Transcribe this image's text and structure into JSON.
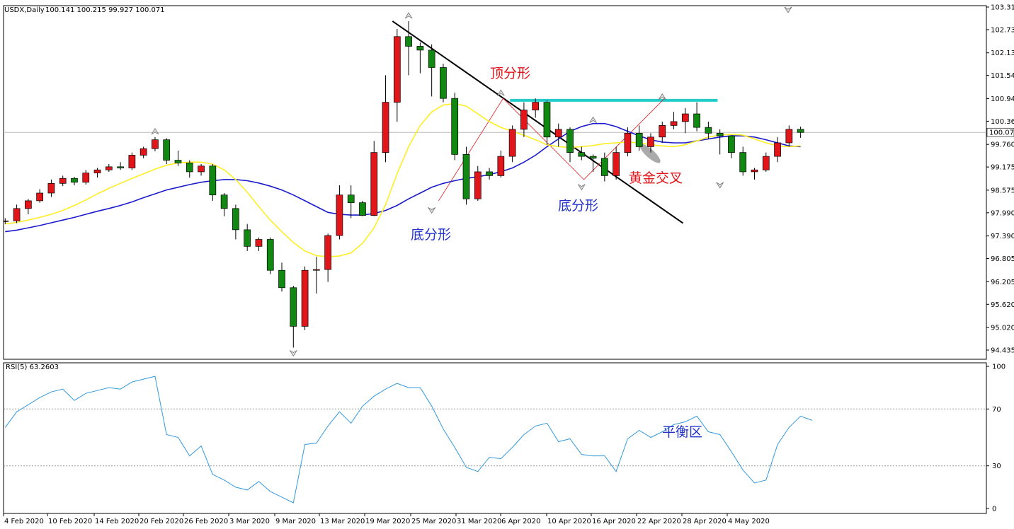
{
  "main_panel": {
    "symbol_label": "USDX,Daily",
    "ohlc_label": "100.141 100.215 99.927 100.071",
    "current_price_label": "100.071"
  },
  "rsi_panel": {
    "label": "RSI(5) 63.2603"
  },
  "annotations": {
    "top_fractal": "顶分形",
    "bottom_fractal_1": "底分形",
    "bottom_fractal_2": "底分形",
    "golden_cross": "黄金交叉",
    "balance_zone": "平衡区"
  },
  "colors": {
    "bull": "#e0161b",
    "bear": "#118811",
    "ma_fast": "#ffee22",
    "ma_slow": "#1a1acc",
    "rsi_line": "#3399dd",
    "resistance": "#22cccc",
    "annotation_red": "#e0161b",
    "annotation_blue": "#2233cc"
  },
  "chart_data": [
    {
      "type": "candlestick",
      "symbol": "USDX",
      "timeframe": "Daily",
      "y_ticks": [
        "103.315",
        "102.730",
        "102.130",
        "101.545",
        "100.945",
        "100.360",
        "99.760",
        "99.175",
        "98.575",
        "97.990",
        "97.390",
        "96.805",
        "96.205",
        "95.620",
        "95.020",
        "94.435"
      ],
      "ylim": [
        94.435,
        103.315
      ],
      "x_ticks": [
        "4 Feb 2020",
        "10 Feb 2020",
        "14 Feb 2020",
        "20 Feb 2020",
        "26 Feb 2020",
        "3 Mar 2020",
        "9 Mar 2020",
        "13 Mar 2020",
        "19 Mar 2020",
        "25 Mar 2020",
        "31 Mar 2020",
        "6 Apr 2020",
        "10 Apr 2020",
        "16 Apr 2020",
        "22 Apr 2020",
        "28 Apr 2020",
        "4 May 2020"
      ],
      "candles": [
        [
          97.78,
          97.85,
          97.7,
          97.78
        ],
        [
          97.78,
          98.2,
          97.72,
          98.1
        ],
        [
          98.1,
          98.35,
          97.95,
          98.3
        ],
        [
          98.3,
          98.6,
          98.25,
          98.5
        ],
        [
          98.5,
          98.85,
          98.4,
          98.75
        ],
        [
          98.75,
          98.95,
          98.68,
          98.88
        ],
        [
          98.88,
          98.92,
          98.7,
          98.78
        ],
        [
          98.78,
          99.1,
          98.72,
          99.02
        ],
        [
          99.02,
          99.15,
          98.9,
          99.1
        ],
        [
          99.1,
          99.25,
          99.05,
          99.18
        ],
        [
          99.18,
          99.3,
          99.1,
          99.15
        ],
        [
          99.15,
          99.55,
          99.1,
          99.48
        ],
        [
          99.48,
          99.7,
          99.4,
          99.65
        ],
        [
          99.65,
          99.95,
          99.58,
          99.88
        ],
        [
          99.88,
          99.92,
          99.25,
          99.35
        ],
        [
          99.35,
          99.6,
          99.2,
          99.28
        ],
        [
          99.28,
          99.35,
          98.9,
          99.05
        ],
        [
          99.05,
          99.25,
          98.95,
          99.2
        ],
        [
          99.2,
          99.25,
          98.3,
          98.45
        ],
        [
          98.45,
          98.5,
          97.9,
          98.1
        ],
        [
          98.1,
          98.2,
          97.3,
          97.55
        ],
        [
          97.55,
          97.7,
          97.0,
          97.12
        ],
        [
          97.12,
          97.35,
          97.0,
          97.3
        ],
        [
          97.3,
          97.35,
          96.4,
          96.5
        ],
        [
          96.5,
          96.7,
          95.95,
          96.05
        ],
        [
          96.05,
          96.1,
          94.5,
          95.05
        ],
        [
          95.05,
          96.6,
          94.95,
          96.5
        ],
        [
          96.5,
          96.85,
          95.9,
          96.52
        ],
        [
          96.52,
          97.45,
          96.2,
          97.4
        ],
        [
          97.4,
          98.7,
          97.3,
          98.45
        ],
        [
          98.45,
          98.7,
          97.85,
          98.25
        ],
        [
          98.25,
          98.3,
          97.9,
          97.92
        ],
        [
          97.92,
          99.85,
          97.9,
          99.55
        ],
        [
          99.55,
          101.55,
          99.3,
          100.85
        ],
        [
          100.85,
          102.75,
          100.35,
          102.55
        ],
        [
          102.55,
          102.95,
          101.55,
          102.3
        ],
        [
          102.3,
          102.4,
          101.6,
          102.2
        ],
        [
          102.2,
          102.35,
          101.0,
          101.75
        ],
        [
          101.75,
          101.85,
          100.85,
          100.95
        ],
        [
          100.95,
          101.1,
          99.35,
          99.5
        ],
        [
          99.5,
          99.7,
          98.2,
          98.35
        ],
        [
          98.35,
          99.2,
          98.3,
          99.05
        ],
        [
          99.05,
          99.15,
          98.85,
          98.95
        ],
        [
          98.95,
          99.6,
          98.9,
          99.45
        ],
        [
          99.45,
          100.25,
          99.3,
          100.15
        ],
        [
          100.15,
          100.85,
          99.95,
          100.65
        ],
        [
          100.65,
          100.95,
          100.45,
          100.85
        ],
        [
          100.85,
          100.9,
          99.75,
          99.95
        ],
        [
          99.95,
          100.3,
          99.7,
          100.15
        ],
        [
          100.15,
          100.2,
          99.3,
          99.55
        ],
        [
          99.55,
          99.7,
          99.35,
          99.45
        ],
        [
          99.45,
          99.5,
          99.05,
          99.4
        ],
        [
          99.4,
          99.55,
          98.8,
          98.95
        ],
        [
          98.95,
          99.7,
          98.85,
          99.55
        ],
        [
          99.55,
          100.2,
          99.45,
          100.05
        ],
        [
          100.05,
          100.25,
          99.6,
          99.7
        ],
        [
          99.7,
          100.05,
          99.55,
          99.95
        ],
        [
          99.95,
          100.35,
          99.8,
          100.25
        ],
        [
          100.25,
          100.6,
          100.15,
          100.35
        ],
        [
          100.35,
          100.7,
          100.05,
          100.55
        ],
        [
          100.55,
          100.85,
          100.1,
          100.2
        ],
        [
          100.2,
          100.35,
          99.9,
          100.05
        ],
        [
          100.05,
          100.15,
          99.5,
          99.98
        ],
        [
          99.98,
          100.0,
          99.4,
          99.55
        ],
        [
          99.55,
          99.7,
          98.95,
          99.05
        ],
        [
          99.05,
          99.15,
          98.85,
          99.1
        ],
        [
          99.1,
          99.55,
          99.05,
          99.45
        ],
        [
          99.45,
          99.95,
          99.3,
          99.8
        ],
        [
          99.8,
          100.25,
          99.7,
          100.15
        ],
        [
          100.15,
          100.22,
          99.93,
          100.07
        ]
      ],
      "ma_fast": [
        97.7,
        97.74,
        97.8,
        97.87,
        97.95,
        98.05,
        98.18,
        98.32,
        98.48,
        98.62,
        98.75,
        98.88,
        99.0,
        99.12,
        99.22,
        99.28,
        99.3,
        99.3,
        99.25,
        99.1,
        98.85,
        98.52,
        98.15,
        97.8,
        97.5,
        97.22,
        97.0,
        96.88,
        96.85,
        96.87,
        96.95,
        97.2,
        97.6,
        98.2,
        99.0,
        99.7,
        100.25,
        100.6,
        100.78,
        100.82,
        100.75,
        100.55,
        100.35,
        100.2,
        100.1,
        100.0,
        99.88,
        99.75,
        99.7,
        99.68,
        99.7,
        99.73,
        99.78,
        99.8,
        99.82,
        99.8,
        99.75,
        99.72,
        99.7,
        99.75,
        99.85,
        99.95,
        100.0,
        100.02,
        100.0,
        99.9,
        99.8,
        99.72,
        99.7,
        99.72
      ],
      "ma_slow": [
        97.5,
        97.54,
        97.6,
        97.66,
        97.73,
        97.8,
        97.87,
        97.95,
        98.03,
        98.1,
        98.18,
        98.27,
        98.38,
        98.48,
        98.58,
        98.65,
        98.72,
        98.78,
        98.82,
        98.85,
        98.85,
        98.82,
        98.76,
        98.68,
        98.58,
        98.45,
        98.3,
        98.15,
        98.0,
        97.95,
        97.93,
        97.93,
        97.97,
        98.05,
        98.18,
        98.35,
        98.5,
        98.65,
        98.75,
        98.82,
        98.88,
        98.92,
        98.98,
        99.05,
        99.15,
        99.3,
        99.48,
        99.7,
        99.9,
        100.1,
        100.22,
        100.3,
        100.3,
        100.22,
        100.1,
        99.98,
        99.88,
        99.82,
        99.8,
        99.8,
        99.85,
        99.9,
        99.95,
        99.98,
        99.98,
        99.95,
        99.88,
        99.8,
        99.72,
        99.7
      ],
      "annotations": {
        "resistance_level": 100.9
      }
    },
    {
      "type": "line",
      "name": "RSI(5)",
      "last_value": 63.2603,
      "y_ticks": [
        "100",
        "70",
        "30",
        "0"
      ],
      "ylim": [
        0,
        100
      ],
      "levels": [
        30,
        70
      ],
      "values": [
        57,
        68,
        73,
        78,
        82,
        84,
        76,
        81,
        83,
        85,
        84,
        89,
        91,
        93,
        52,
        50,
        37,
        44,
        24,
        20,
        15,
        13,
        19,
        12,
        8,
        4,
        45,
        46,
        58,
        68,
        60,
        72,
        79,
        84,
        88,
        85,
        85,
        72,
        56,
        43,
        29,
        26,
        36,
        35,
        43,
        52,
        58,
        60,
        47,
        49,
        38,
        37,
        37,
        26,
        49,
        55,
        50,
        54,
        59,
        61,
        65,
        54,
        52,
        40,
        27,
        18,
        20,
        45,
        57,
        65,
        62
      ]
    }
  ]
}
